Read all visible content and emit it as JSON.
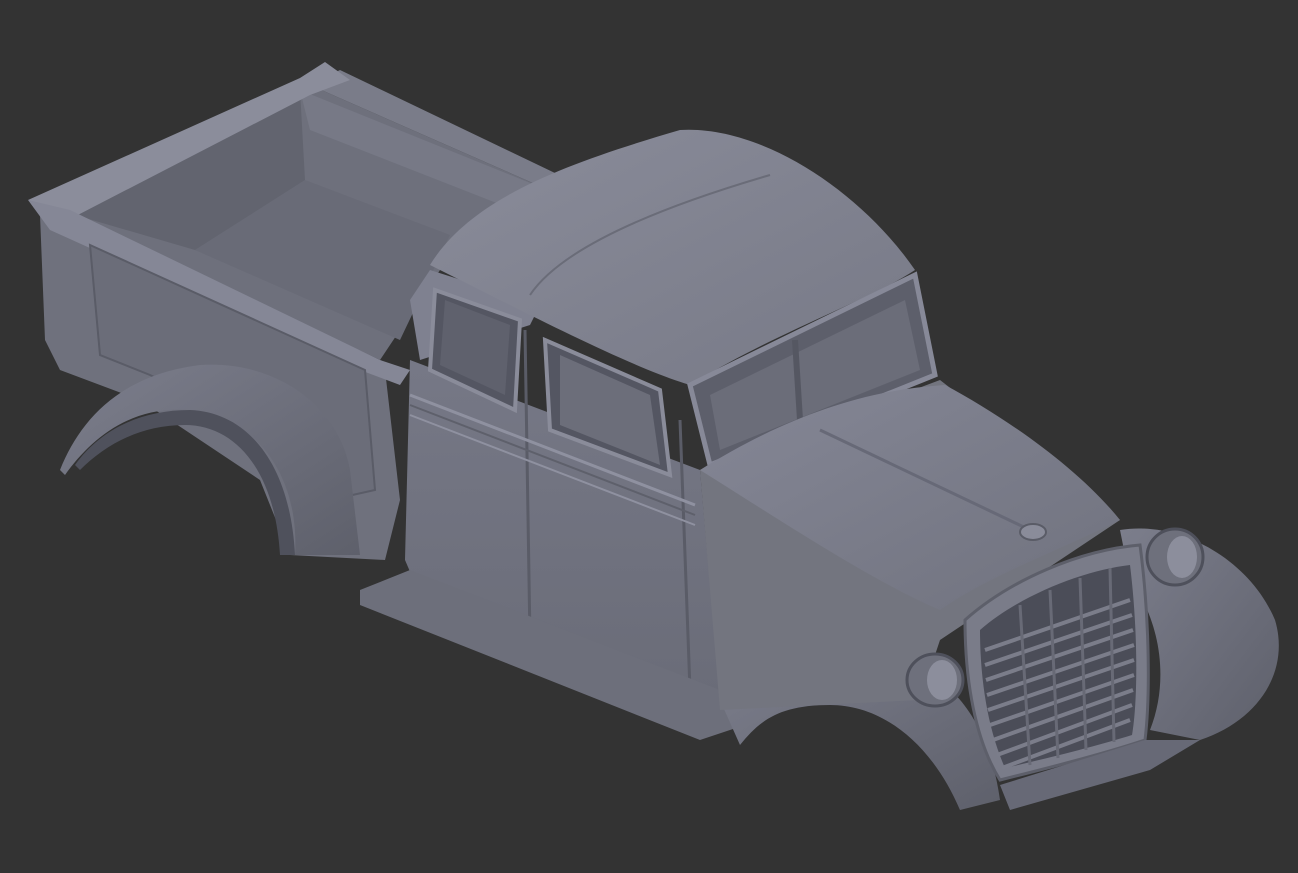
{
  "viewport": {
    "background": "#333333",
    "model": {
      "name": "pickup-truck-body",
      "shading": "solid",
      "colors": {
        "body": "#7d7f8e",
        "light": "#9698a6",
        "mid": "#72747f",
        "dark": "#5d5f6a",
        "deep": "#4a4c57",
        "edge": "#3f414b"
      }
    }
  }
}
